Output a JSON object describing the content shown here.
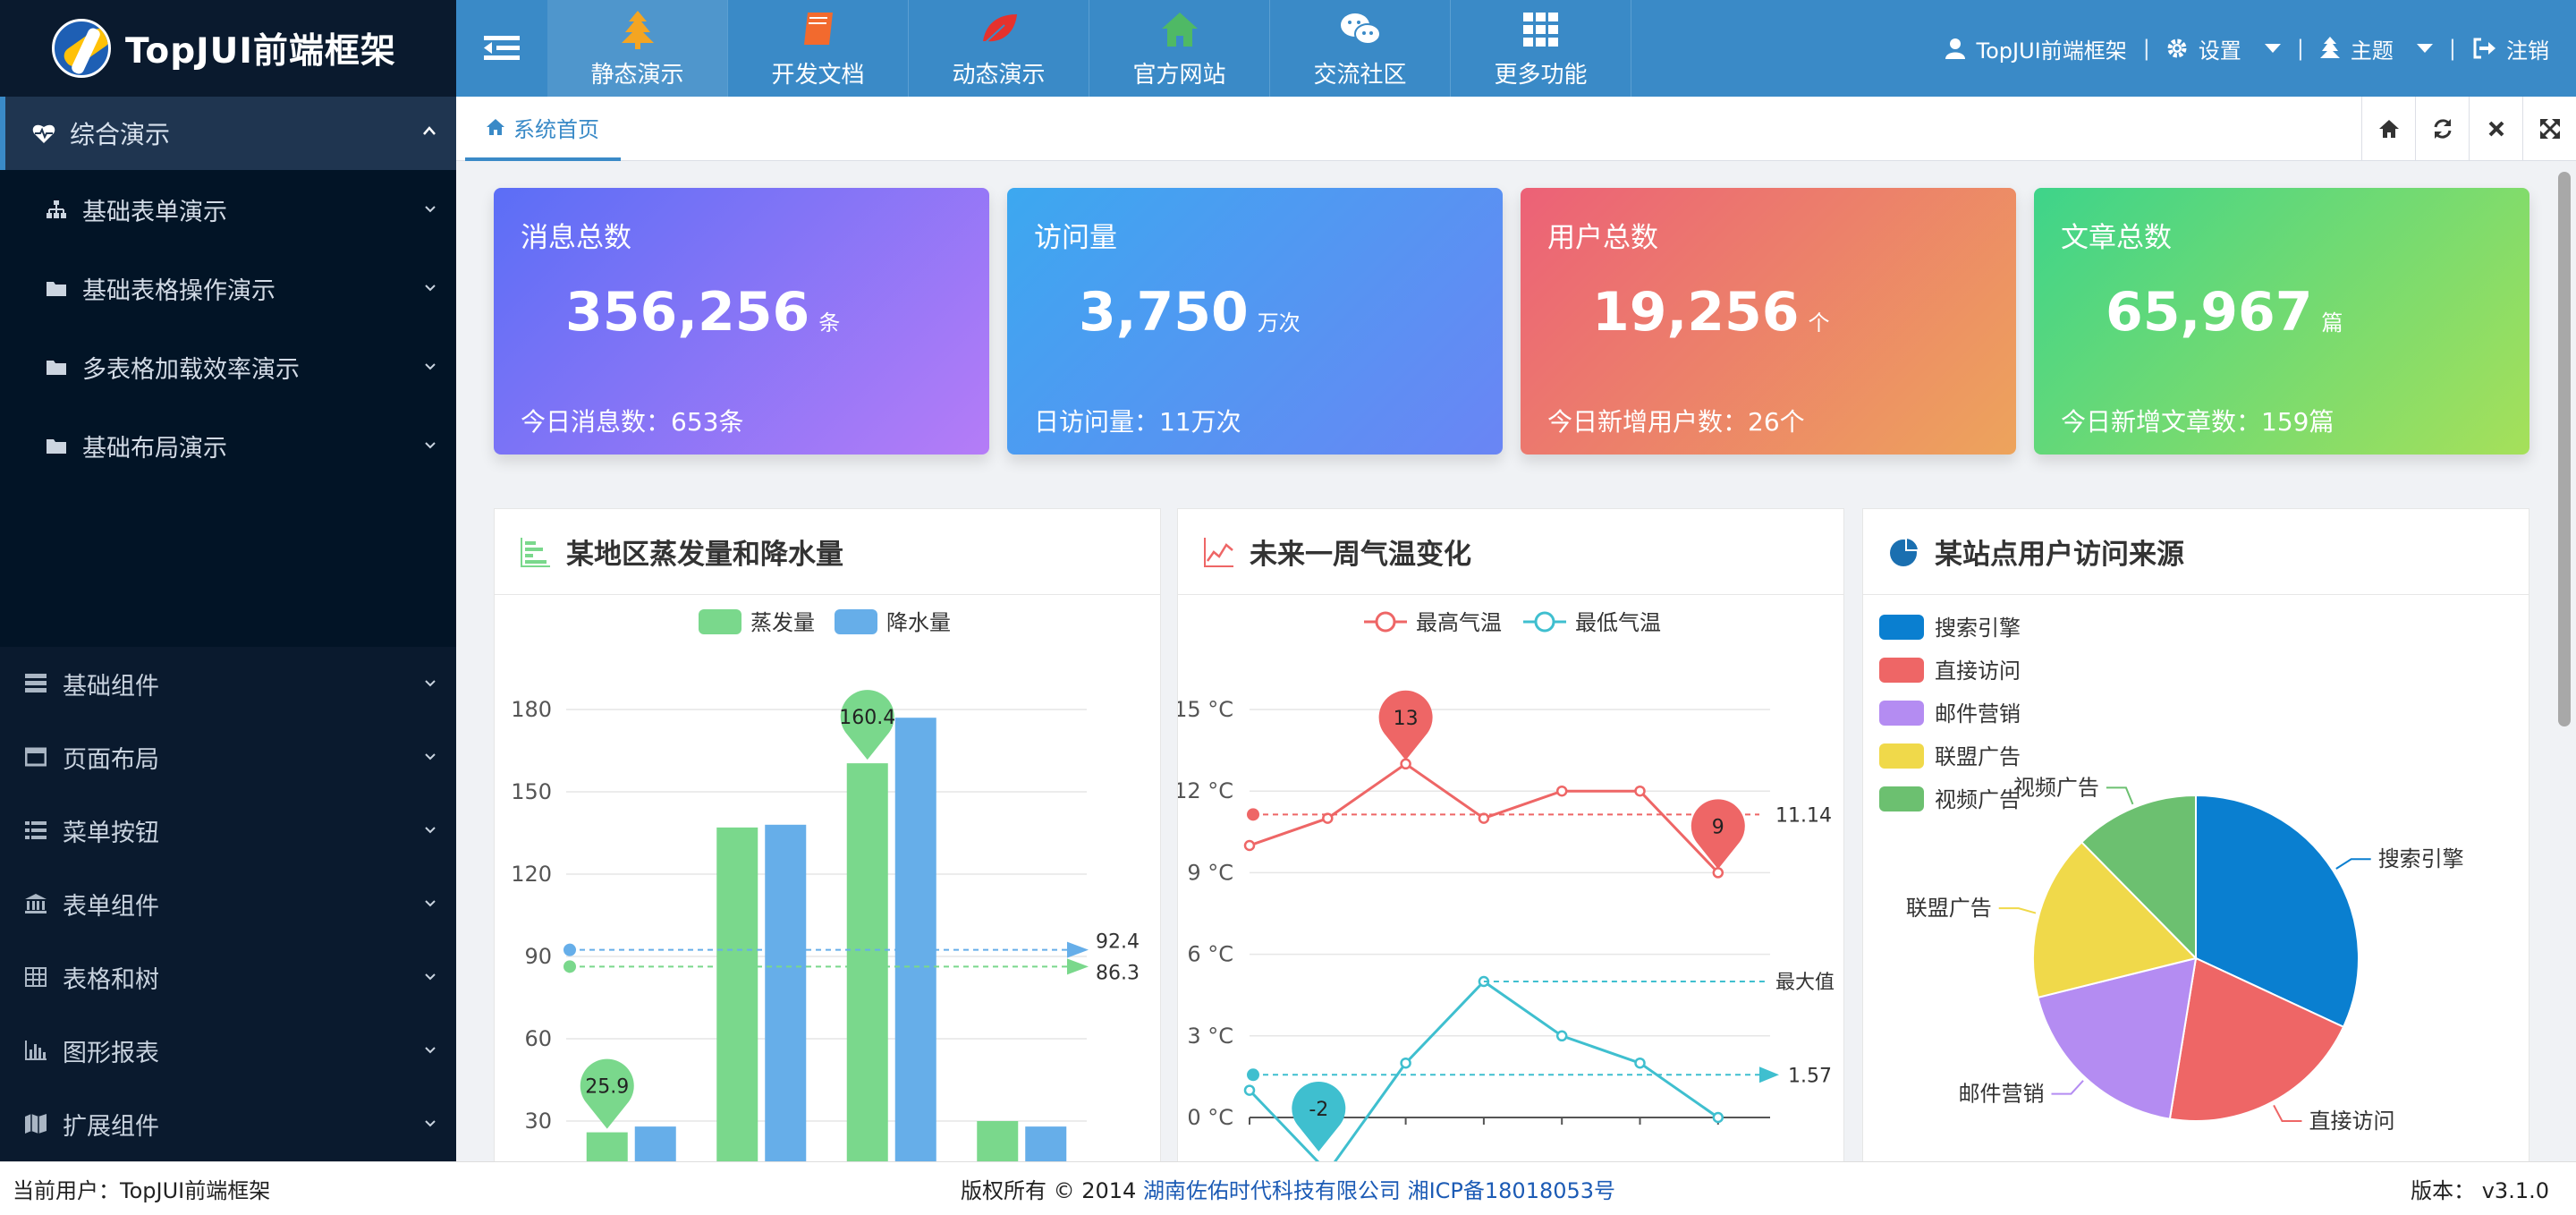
{
  "app": {
    "title": "TopJUI前端框架"
  },
  "nav": {
    "items": [
      {
        "label": "静态演示",
        "icon": "tree-icon",
        "color": "#f4a522"
      },
      {
        "label": "开发文档",
        "icon": "book-icon",
        "color": "#f26a2e"
      },
      {
        "label": "动态演示",
        "icon": "leaf-icon",
        "color": "#e5322d"
      },
      {
        "label": "官方网站",
        "icon": "home-icon",
        "color": "#4fb965"
      },
      {
        "label": "交流社区",
        "icon": "wechat-icon",
        "color": "#ffffff"
      },
      {
        "label": "更多功能",
        "icon": "grid-icon",
        "color": "#ffffff"
      }
    ]
  },
  "topRight": {
    "user": "TopJUI前端框架",
    "settings": "设置",
    "theme": "主题",
    "logout": "注销"
  },
  "sidebar": {
    "head": "综合演示",
    "subItems": [
      {
        "label": "基础表单演示",
        "icon": "sitemap-icon"
      },
      {
        "label": "基础表格操作演示",
        "icon": "folder-icon"
      },
      {
        "label": "多表格加载效率演示",
        "icon": "folder-icon"
      },
      {
        "label": "基础布局演示",
        "icon": "folder-icon"
      }
    ],
    "groups": [
      {
        "label": "基础组件",
        "icon": "stack-icon"
      },
      {
        "label": "页面布局",
        "icon": "window-icon"
      },
      {
        "label": "菜单按钮",
        "icon": "list-icon"
      },
      {
        "label": "表单组件",
        "icon": "bank-icon"
      },
      {
        "label": "表格和树",
        "icon": "table-icon"
      },
      {
        "label": "图形报表",
        "icon": "bar-chart-icon"
      },
      {
        "label": "扩展组件",
        "icon": "map-icon"
      }
    ]
  },
  "tabs": {
    "home": "系统首页"
  },
  "stats": [
    {
      "title": "消息总数",
      "value": "356,256",
      "unit": "条",
      "sub": "今日消息数：653条",
      "from": "#5b6ef6",
      "to": "#b57cf7"
    },
    {
      "title": "访问量",
      "value": "3,750",
      "unit": "万次",
      "sub": "日访问量：11万次",
      "from": "#3ca8f0",
      "to": "#6a85f4"
    },
    {
      "title": "用户总数",
      "value": "19,256",
      "unit": "个",
      "sub": "今日新增用户数：26个",
      "from": "#ec6177",
      "to": "#eda45c"
    },
    {
      "title": "文章总数",
      "value": "65,967",
      "unit": "篇",
      "sub": "今日新增文章数：159篇",
      "from": "#3ed48a",
      "to": "#a6e05a"
    }
  ],
  "panels": {
    "bar": {
      "title": "某地区蒸发量和降水量"
    },
    "line": {
      "title": "未来一周气温变化"
    },
    "pie": {
      "title": "某站点用户访问来源"
    }
  },
  "chart_data": [
    {
      "type": "bar",
      "title": "某地区蒸发量和降水量",
      "legend": [
        "蒸发量",
        "降水量"
      ],
      "colors": [
        "#7ad88c",
        "#66aee9"
      ],
      "yticks": [
        30,
        60,
        90,
        120,
        150,
        180
      ],
      "ylim": [
        0,
        180
      ],
      "series": [
        {
          "name": "蒸发量",
          "values": [
            25.9,
            137,
            160.4,
            30
          ]
        },
        {
          "name": "降水量",
          "values": [
            28,
            138,
            177,
            28
          ]
        }
      ],
      "markPoints": {
        "max": "160.4",
        "min": "25.9"
      },
      "markLines": {
        "蒸发量": "86.3",
        "降水量": "92.4"
      }
    },
    {
      "type": "line",
      "title": "未来一周气温变化",
      "legend": [
        "最高气温",
        "最低气温"
      ],
      "colors": [
        "#ee6666",
        "#3fbfcf"
      ],
      "yticks": [
        "0 °C",
        "3 °C",
        "6 °C",
        "9 °C",
        "12 °C",
        "15 °C"
      ],
      "ylim": [
        0,
        15
      ],
      "series": [
        {
          "name": "最高气温",
          "values": [
            10,
            11,
            13,
            11,
            12,
            12,
            9
          ]
        },
        {
          "name": "最低气温",
          "values": [
            1,
            -2,
            2,
            5,
            3,
            2,
            0
          ]
        }
      ],
      "markPoints": {
        "max": "13",
        "min": "-2",
        "end": "9"
      },
      "markLines": {
        "最高气温": "11.14",
        "最低气温": "1.57",
        "label": "最大值"
      }
    },
    {
      "type": "pie",
      "title": "某站点用户访问来源",
      "legend": [
        "搜索引擎",
        "直接访问",
        "邮件营销",
        "联盟广告",
        "视频广告"
      ],
      "colors": [
        "#0a7fd0",
        "#ee6666",
        "#b48cf2",
        "#f0d94a",
        "#6cc070"
      ],
      "values": [
        1548,
        1000,
        900,
        800,
        600
      ]
    }
  ],
  "footer": {
    "user": "当前用户：TopJUI前端框架",
    "copyright": "版权所有 © 2014",
    "company": "湖南佐佑时代科技有限公司",
    "icp": "湘ICP备18018053号",
    "version": "版本： v3.1.0"
  }
}
